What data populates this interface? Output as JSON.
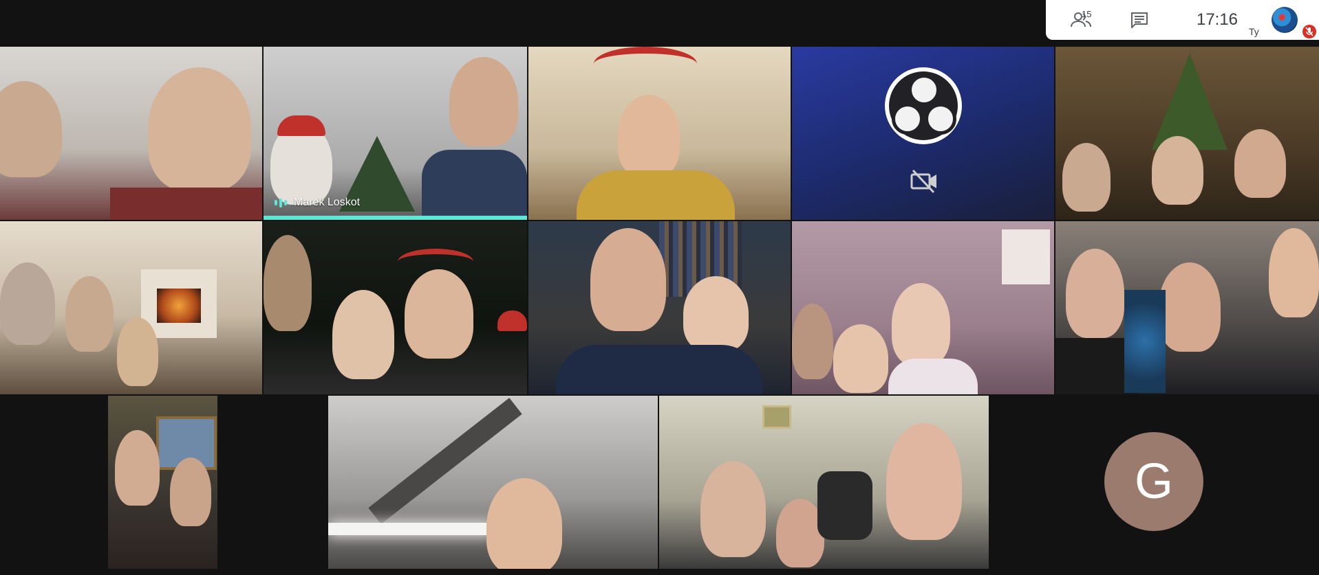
{
  "info_panel": {
    "participants_icon": "people-icon",
    "participants_count": "15",
    "chat_icon": "chat-icon",
    "time": "17:16",
    "self_label": "Ty",
    "mic_status_icon": "mic-off-icon"
  },
  "speaker": {
    "name": "Marek Loskot",
    "talking_indicator_icon": "audio-equalizer-icon"
  },
  "camera_off_icon": "video-off-icon",
  "avatar_tile": {
    "initial": "G"
  },
  "colors": {
    "background": "#121212",
    "active_speaker": "#5ee7d6",
    "avatar": "#9a7b6e",
    "obs_background": "#1c2a6b",
    "mic_off": "#d93025"
  }
}
